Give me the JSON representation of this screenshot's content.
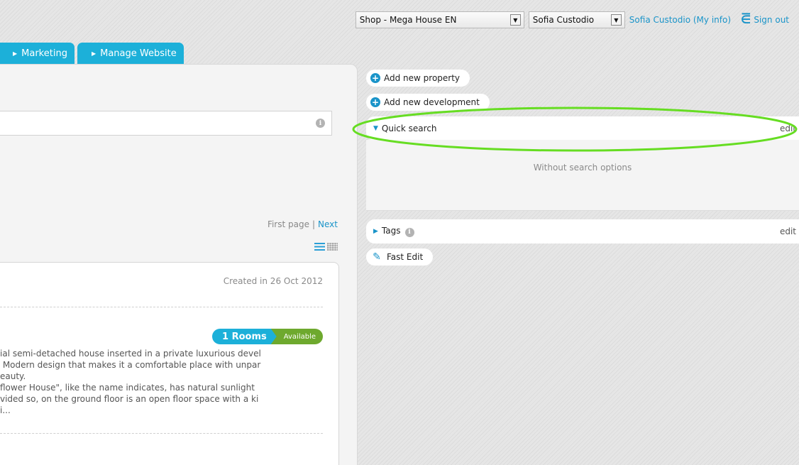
{
  "topbar": {
    "shop_select": "Shop - Mega House EN",
    "user_select": "Sofia Custodio",
    "my_info_link": "Sofia Custodio (My info)",
    "sign_out": "Sign out"
  },
  "tabs": [
    {
      "label": "Marketing"
    },
    {
      "label": "Manage Website"
    }
  ],
  "pager": {
    "first_page": "First page",
    "separator": "|",
    "next": "Next"
  },
  "card": {
    "created": "Created in 26 Oct 2012",
    "rooms_badge": "1 Rooms",
    "status_badge": "Available",
    "description": "ial semi-detached house inserted in a private luxurious devel\n Modern design that makes it a comfortable place with unpar\neauty.\nflower House\", like the name indicates, has natural sunlight\nvided so, on the ground floor is an open floor space with a ki\ni..."
  },
  "sidebar": {
    "add_property": "Add new property",
    "add_development": "Add new development",
    "quick_search": {
      "title": "Quick search",
      "edit": "edit",
      "empty": "Without search options"
    },
    "tags": {
      "title": "Tags",
      "edit": "edit"
    },
    "fast_edit": "Fast Edit"
  },
  "colors": {
    "accent": "#1cb0d9",
    "link": "#1a94c9",
    "available": "#6ea92e",
    "highlight": "#66dd22"
  },
  "icons": [
    "chevron-down-icon",
    "sign-out-icon",
    "caret-right-icon",
    "info-icon",
    "list-view-icon",
    "grid-view-icon",
    "plus-icon",
    "pencil-icon"
  ]
}
